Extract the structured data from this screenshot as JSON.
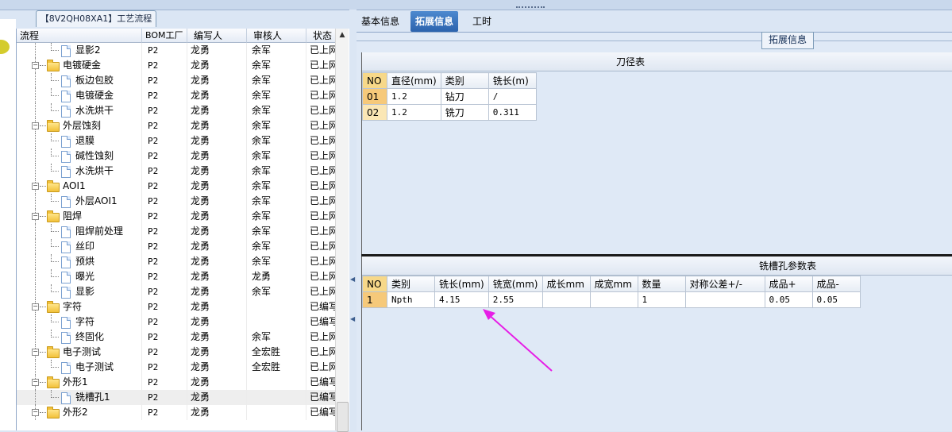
{
  "left_panel": {
    "tab_title": "【8V2QH08XA1】工艺流程",
    "columns": [
      "流程",
      "BOM工厂",
      "编写人",
      "审核人",
      "状态"
    ],
    "rows": [
      {
        "level": 1,
        "type": "doc",
        "label": "显影2",
        "factory": "P2",
        "writer": "龙勇",
        "reviewer": "余军",
        "status": "已上网"
      },
      {
        "level": 0,
        "type": "folder",
        "label": "电镀硬金",
        "factory": "P2",
        "writer": "龙勇",
        "reviewer": "余军",
        "status": "已上网"
      },
      {
        "level": 1,
        "type": "doc",
        "label": "板边包胶",
        "factory": "P2",
        "writer": "龙勇",
        "reviewer": "余军",
        "status": "已上网"
      },
      {
        "level": 1,
        "type": "doc",
        "label": "电镀硬金",
        "factory": "P2",
        "writer": "龙勇",
        "reviewer": "余军",
        "status": "已上网"
      },
      {
        "level": 1,
        "type": "doc",
        "label": "水洗烘干",
        "factory": "P2",
        "writer": "龙勇",
        "reviewer": "余军",
        "status": "已上网"
      },
      {
        "level": 0,
        "type": "folder",
        "label": "外层蚀刻",
        "factory": "P2",
        "writer": "龙勇",
        "reviewer": "余军",
        "status": "已上网"
      },
      {
        "level": 1,
        "type": "doc",
        "label": "退膜",
        "factory": "P2",
        "writer": "龙勇",
        "reviewer": "余军",
        "status": "已上网"
      },
      {
        "level": 1,
        "type": "doc",
        "label": "碱性蚀刻",
        "factory": "P2",
        "writer": "龙勇",
        "reviewer": "余军",
        "status": "已上网"
      },
      {
        "level": 1,
        "type": "doc",
        "label": "水洗烘干",
        "factory": "P2",
        "writer": "龙勇",
        "reviewer": "余军",
        "status": "已上网"
      },
      {
        "level": 0,
        "type": "folder",
        "label": "AOI1",
        "factory": "P2",
        "writer": "龙勇",
        "reviewer": "余军",
        "status": "已上网"
      },
      {
        "level": 1,
        "type": "doc",
        "label": "外层AOI1",
        "factory": "P2",
        "writer": "龙勇",
        "reviewer": "余军",
        "status": "已上网"
      },
      {
        "level": 0,
        "type": "folder",
        "label": "阻焊",
        "factory": "P2",
        "writer": "龙勇",
        "reviewer": "余军",
        "status": "已上网"
      },
      {
        "level": 1,
        "type": "doc",
        "label": "阻焊前处理",
        "factory": "P2",
        "writer": "龙勇",
        "reviewer": "余军",
        "status": "已上网"
      },
      {
        "level": 1,
        "type": "doc",
        "label": "丝印",
        "factory": "P2",
        "writer": "龙勇",
        "reviewer": "余军",
        "status": "已上网"
      },
      {
        "level": 1,
        "type": "doc",
        "label": "预烘",
        "factory": "P2",
        "writer": "龙勇",
        "reviewer": "余军",
        "status": "已上网"
      },
      {
        "level": 1,
        "type": "doc",
        "label": "曝光",
        "factory": "P2",
        "writer": "龙勇",
        "reviewer": "龙勇",
        "status": "已上网"
      },
      {
        "level": 1,
        "type": "doc",
        "label": "显影",
        "factory": "P2",
        "writer": "龙勇",
        "reviewer": "余军",
        "status": "已上网"
      },
      {
        "level": 0,
        "type": "folder",
        "label": "字符",
        "factory": "P2",
        "writer": "龙勇",
        "reviewer": "",
        "status": "已编写"
      },
      {
        "level": 1,
        "type": "doc",
        "label": "字符",
        "factory": "P2",
        "writer": "龙勇",
        "reviewer": "",
        "status": "已编写"
      },
      {
        "level": 1,
        "type": "doc",
        "label": "终固化",
        "factory": "P2",
        "writer": "龙勇",
        "reviewer": "余军",
        "status": "已上网"
      },
      {
        "level": 0,
        "type": "folder",
        "label": "电子测试",
        "factory": "P2",
        "writer": "龙勇",
        "reviewer": "全宏胜",
        "status": "已上网"
      },
      {
        "level": 1,
        "type": "doc",
        "label": "电子测试",
        "factory": "P2",
        "writer": "龙勇",
        "reviewer": "全宏胜",
        "status": "已上网"
      },
      {
        "level": 0,
        "type": "folder",
        "label": "外形1",
        "factory": "P2",
        "writer": "龙勇",
        "reviewer": "",
        "status": "已编写"
      },
      {
        "level": 1,
        "type": "doc",
        "label": "铣槽孔1",
        "factory": "P2",
        "writer": "龙勇",
        "reviewer": "",
        "status": "已编写",
        "selected": true
      },
      {
        "level": 0,
        "type": "folder",
        "label": "外形2",
        "factory": "P2",
        "writer": "龙勇",
        "reviewer": "",
        "status": "已编写"
      }
    ]
  },
  "right_panel": {
    "tabs": [
      "基本信息",
      "拓展信息",
      "工时"
    ],
    "active_tab": "拓展信息",
    "group_title": "拓展信息",
    "tool_table": {
      "title": "刀径表",
      "headers": [
        "NO",
        "直径(mm)",
        "类别",
        "铣长(m)"
      ],
      "rows": [
        [
          "01",
          "1.2",
          "钻刀",
          "/"
        ],
        [
          "02",
          "1.2",
          "铣刀",
          "0.311"
        ]
      ]
    },
    "slot_table": {
      "title": "铣槽孔参数表",
      "headers": [
        "NO",
        "类别",
        "铣长(mm)",
        "铣宽(mm)",
        "成长mm",
        "成宽mm",
        "数量",
        "对称公差+/-",
        "成品+",
        "成品-"
      ],
      "rows": [
        [
          "1",
          "Npth",
          "4.15",
          "2.55",
          "",
          "",
          "1",
          "",
          "0.05",
          "0.05"
        ]
      ]
    }
  },
  "colors": {
    "active_tab": "#2c63ad",
    "annotation_arrow": "#e61ee6",
    "background": "#dfe9f6"
  }
}
